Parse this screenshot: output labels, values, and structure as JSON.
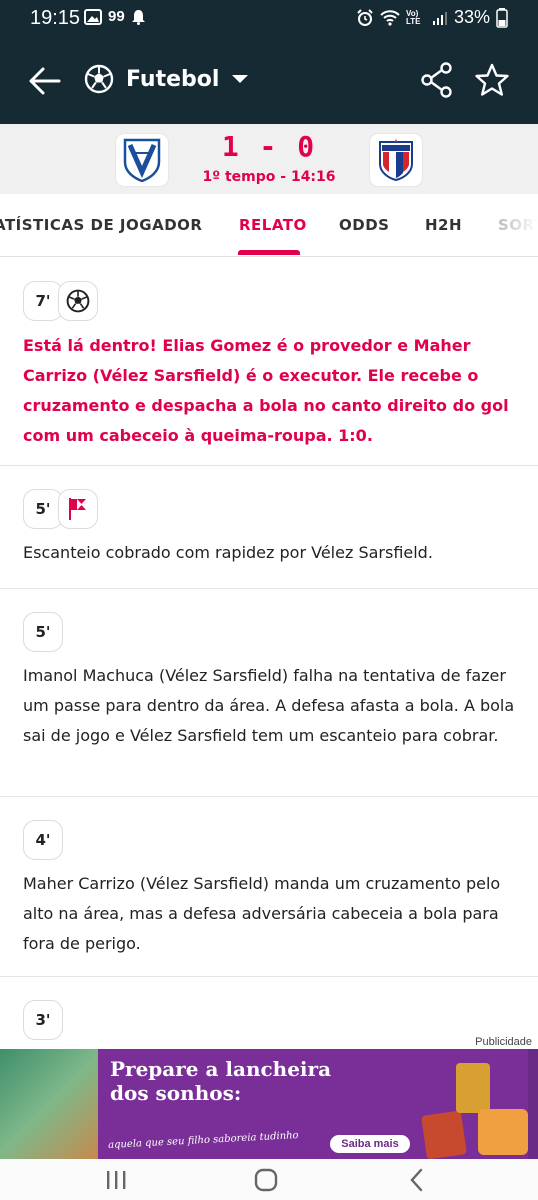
{
  "status_bar": {
    "time": "19:15",
    "notification_count": "99",
    "battery": "33%",
    "network": "Vo) LTE"
  },
  "app_bar": {
    "sport_label": "Futebol",
    "sport_icon": "soccer-ball-icon"
  },
  "match": {
    "home_team_crest": "velez-sarsfield-crest",
    "away_team_crest": "fortaleza-crest",
    "away_crest_text": "FORTALEZA",
    "score": "1 - 0",
    "period": "1º tempo - 14:16"
  },
  "tabs": [
    {
      "label": "ATÍSTICAS DE JOGADOR",
      "active": false
    },
    {
      "label": "RELATO",
      "active": true
    },
    {
      "label": "ODDS",
      "active": false
    },
    {
      "label": "H2H",
      "active": false
    },
    {
      "label": "SORT",
      "active": false
    }
  ],
  "events": [
    {
      "minute": "7'",
      "icon": "soccer-ball-icon",
      "text": "Está lá dentro! Elias Gomez é o provedor e Maher Carrizo (Vélez Sarsfield) é o executor. Ele recebe o cruzamento e despacha a bola no canto direito do gol com um cabeceio à queima-roupa. 1:0.",
      "highlight": true
    },
    {
      "minute": "5'",
      "icon": "corner-flag-icon",
      "text": "Escanteio cobrado com rapidez por Vélez Sarsfield.",
      "highlight": false
    },
    {
      "minute": "5'",
      "icon": "",
      "text": "Imanol Machuca (Vélez Sarsfield) falha na tentativa de fazer um passe para dentro da área. A defesa afasta a bola. A bola sai de jogo e Vélez Sarsfield tem um escanteio para cobrar.",
      "highlight": false
    },
    {
      "minute": "4'",
      "icon": "",
      "text": "Maher Carrizo (Vélez Sarsfield) manda um cruzamento pelo alto na área, mas a defesa adversária cabeceia a bola para fora de perigo.",
      "highlight": false
    },
    {
      "minute": "3'",
      "icon": "",
      "text": "",
      "highlight": false
    }
  ],
  "ad": {
    "label": "Publicidade",
    "headline": "Prepare a lancheira dos sonhos:",
    "subline": "aquela que seu filho saboreia tudinho",
    "cta": "Saiba mais"
  },
  "colors": {
    "header_bg": "#152a33",
    "accent": "#e0004d",
    "ad_bg": "#6a2b86"
  }
}
